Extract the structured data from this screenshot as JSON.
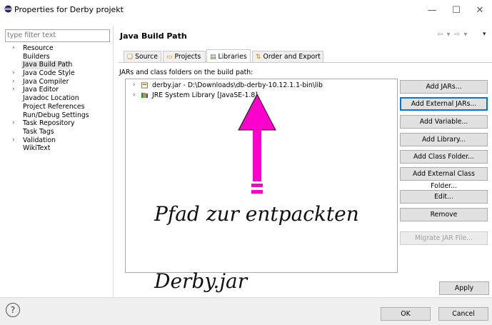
{
  "window": {
    "title": "Properties for Derby projekt",
    "controls": {
      "minimize": "—",
      "maximize": "☐",
      "close": "✕"
    }
  },
  "filter": {
    "placeholder": "type filter text"
  },
  "nav": [
    {
      "label": "Resource",
      "expandable": true
    },
    {
      "label": "Builders",
      "expandable": false
    },
    {
      "label": "Java Build Path",
      "expandable": false,
      "selected": true
    },
    {
      "label": "Java Code Style",
      "expandable": true
    },
    {
      "label": "Java Compiler",
      "expandable": true
    },
    {
      "label": "Java Editor",
      "expandable": true
    },
    {
      "label": "Javadoc Location",
      "expandable": false
    },
    {
      "label": "Project References",
      "expandable": false
    },
    {
      "label": "Run/Debug Settings",
      "expandable": false
    },
    {
      "label": "Task Repository",
      "expandable": true
    },
    {
      "label": "Task Tags",
      "expandable": false
    },
    {
      "label": "Validation",
      "expandable": true
    },
    {
      "label": "WikiText",
      "expandable": false
    }
  ],
  "page": {
    "title": "Java Build Path",
    "nav_arrows": "⇦ ▾ ⇨ ▾",
    "menu": "▾"
  },
  "tabs": [
    {
      "label": "Source",
      "icon": "source-folder-icon"
    },
    {
      "label": "Projects",
      "icon": "projects-folder-icon"
    },
    {
      "label": "Libraries",
      "icon": "libraries-icon",
      "active": true
    },
    {
      "label": "Order and Export",
      "icon": "order-export-icon"
    }
  ],
  "libraries": {
    "label": "JARs and class folders on the build path:",
    "tree": [
      {
        "label": "derby.jar - D:\\Downloads\\db-derby-10.12.1.1-bin\\lib",
        "icon": "jar-icon"
      },
      {
        "label": "JRE System Library [JavaSE-1.8]",
        "icon": "library-icon"
      }
    ]
  },
  "buttons": {
    "add_jars": "Add JARs...",
    "add_external_jars": "Add External JARs...",
    "add_variable": "Add Variable...",
    "add_library": "Add Library...",
    "add_class_folder": "Add Class Folder...",
    "add_external_class_folder": "Add External Class Folder...",
    "edit": "Edit...",
    "remove": "Remove",
    "migrate": "Migrate JAR File...",
    "apply": "Apply",
    "ok": "OK",
    "cancel": "Cancel",
    "help": "?"
  },
  "annotation": {
    "line1": "Pfad zur entpackten",
    "line2": "Derby.jar",
    "arrow_color": "#ff00cc"
  }
}
